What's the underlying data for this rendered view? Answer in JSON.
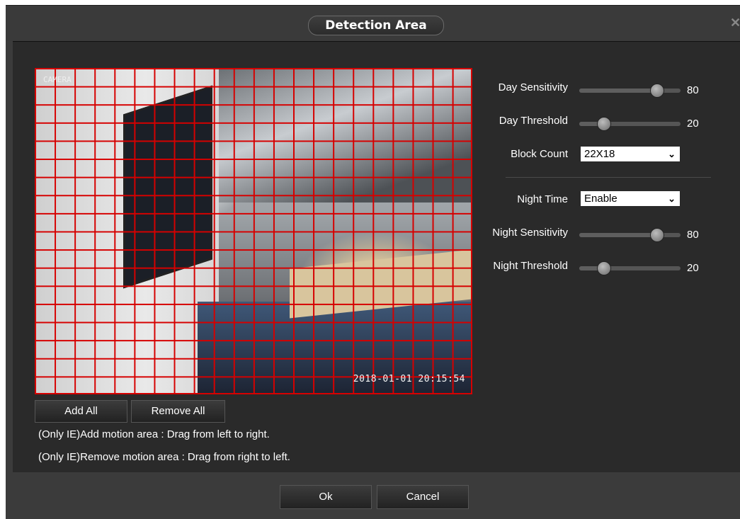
{
  "dialog": {
    "title": "Detection Area",
    "close_glyph": "✕"
  },
  "video": {
    "camera_label": "CAMERA",
    "timestamp": "2018-01-01  20:15:54",
    "grid": {
      "columns": 22,
      "rows": 18,
      "line_color": "#d60000"
    }
  },
  "buttons": {
    "add_all": "Add All",
    "remove_all": "Remove All",
    "ok": "Ok",
    "cancel": "Cancel"
  },
  "hints": {
    "add": "(Only IE)Add motion area : Drag from left to right.",
    "remove": "(Only IE)Remove motion area : Drag from right to left."
  },
  "settings": {
    "day_sensitivity": {
      "label": "Day Sensitivity",
      "value": "80",
      "fraction": 0.76
    },
    "day_threshold": {
      "label": "Day Threshold",
      "value": "20",
      "fraction": 0.24
    },
    "block_count": {
      "label": "Block Count",
      "selected": "22X18"
    },
    "night_time": {
      "label": "Night Time",
      "selected": "Enable"
    },
    "night_sensitivity": {
      "label": "Night Sensitivity",
      "value": "80",
      "fraction": 0.76
    },
    "night_threshold": {
      "label": "Night Threshold",
      "value": "20",
      "fraction": 0.24
    }
  },
  "icons": {
    "dropdown": "chevron-down-icon",
    "close": "close-icon"
  },
  "colors": {
    "background": "#3b3b3b",
    "panel": "#2a2a2a",
    "grid_red": "#d60000"
  }
}
